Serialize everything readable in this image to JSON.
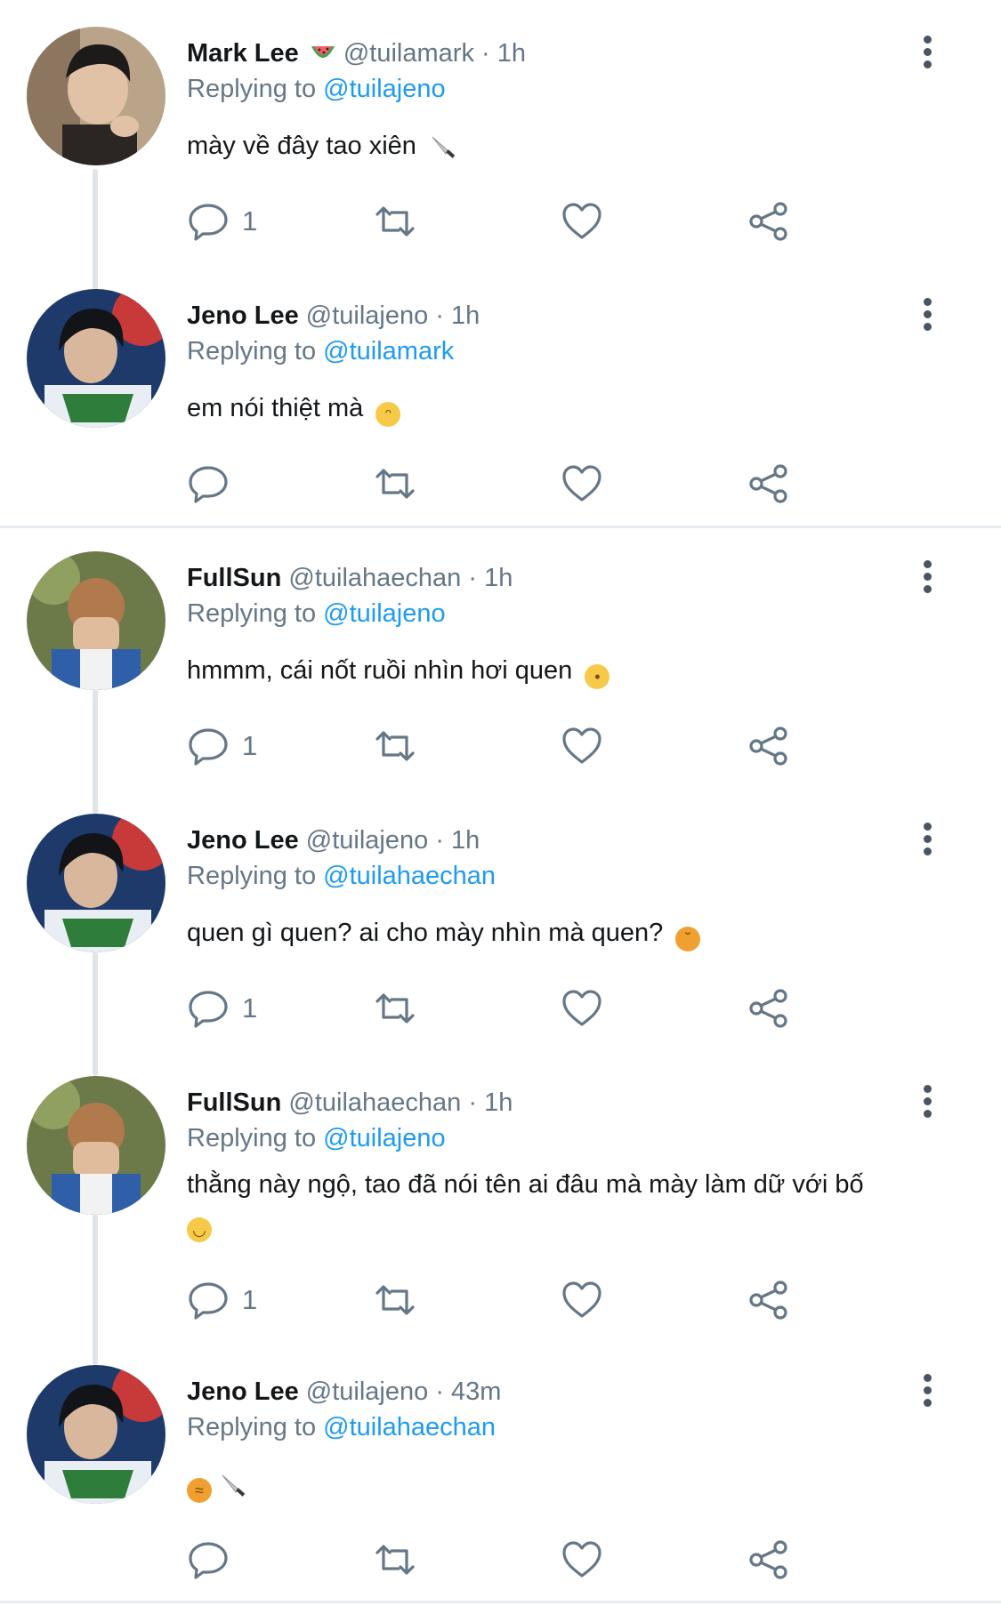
{
  "tweets": [
    {
      "name": "Mark Lee",
      "name_emoji": "watermelon",
      "handle": "@tuilamark",
      "time": "· 1h",
      "replying_prefix": "Replying to",
      "replying_to": "@tuilajeno",
      "text": "mày về đây tao xiên",
      "text_emoji": "knife",
      "reply_count": "1",
      "avatar": "mark-avatar"
    },
    {
      "name": "Jeno Lee",
      "handle": "@tuilajeno",
      "time": "· 1h",
      "replying_prefix": "Replying to",
      "replying_to": "@tuilamark",
      "text": "em nói thiệt mà",
      "text_emoji": "crying-face",
      "reply_count": "",
      "avatar": "jeno-avatar"
    },
    {
      "name": "FullSun",
      "handle": "@tuilahaechan",
      "time": "· 1h",
      "replying_prefix": "Replying to",
      "replying_to": "@tuilajeno",
      "text": "hmmm, cái nốt ruồi nhìn hơi quen",
      "text_emoji": "raised-eyebrow-face",
      "reply_count": "1",
      "avatar": "haechan-avatar"
    },
    {
      "name": "Jeno Lee",
      "handle": "@tuilajeno",
      "time": "· 1h",
      "replying_prefix": "Replying to",
      "replying_to": "@tuilahaechan",
      "text": "quen gì quen? ai cho mày nhìn mà quen?",
      "text_emoji": "angry-face",
      "reply_count": "1",
      "avatar": "jeno-avatar"
    },
    {
      "name": "FullSun",
      "handle": "@tuilahaechan",
      "time": "· 1h",
      "replying_prefix": "Replying to",
      "replying_to": "@tuilajeno",
      "text": "thằng này ngộ, tao đã nói tên ai đâu mà mày làm dữ với bố",
      "text_emoji": "slightly-smiling-face",
      "reply_count": "1",
      "avatar": "haechan-avatar"
    },
    {
      "name": "Jeno Lee",
      "handle": "@tuilajeno",
      "time": "· 43m",
      "replying_prefix": "Replying to",
      "replying_to": "@tuilahaechan",
      "text": "",
      "text_emoji": "steam-face-knife",
      "reply_count": "",
      "avatar": "jeno-avatar"
    }
  ],
  "icons": {
    "reply": "reply-icon",
    "retweet": "retweet-icon",
    "like": "heart-icon",
    "share": "share-icon",
    "more": "more-vertical-icon"
  },
  "colors": {
    "mention": "#1d9bf0",
    "secondary_text": "#657786",
    "icon": "#657786"
  }
}
